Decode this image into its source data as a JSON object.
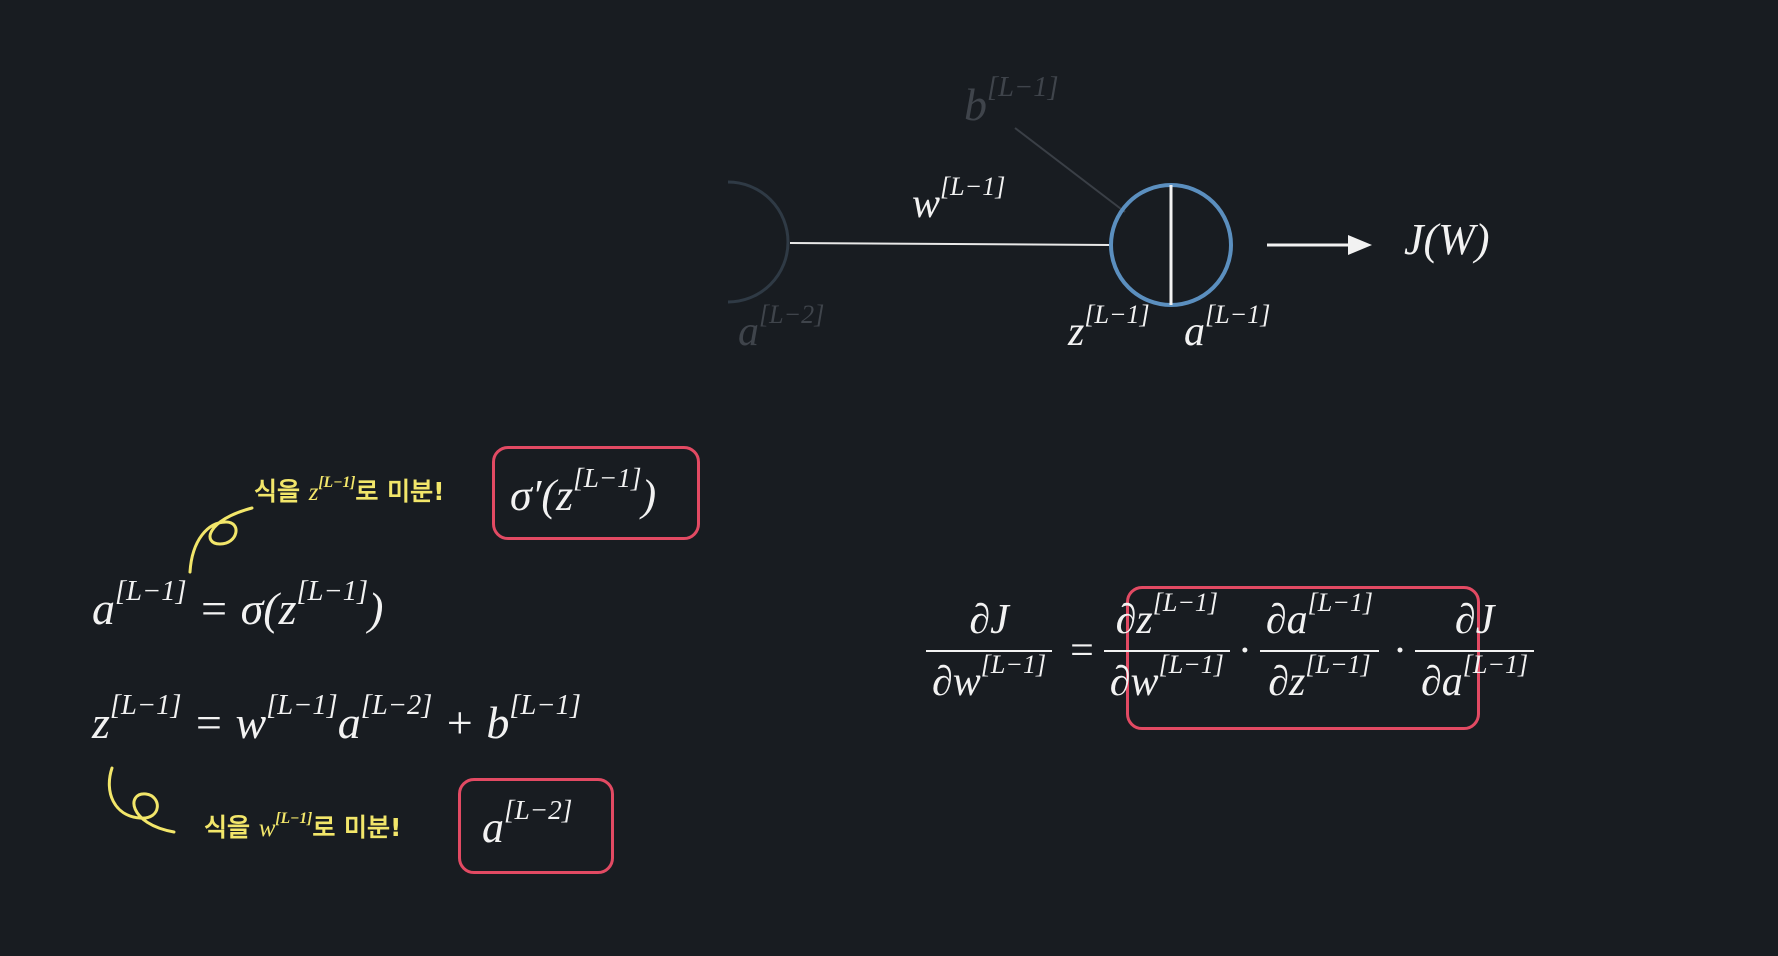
{
  "network": {
    "prev_label": "a",
    "prev_sup": "[L−2]",
    "weight_label": "w",
    "weight_sup": "[L−1]",
    "bias_label": "b",
    "bias_sup": "[L−1]",
    "z_label": "z",
    "z_sup": "[L−1]",
    "a_label": "a",
    "a_sup": "[L−1]",
    "cost_label": "J(W)"
  },
  "left": {
    "top_note_prefix": "식을 ",
    "top_note_var": "z",
    "top_note_sup": "[L−1]",
    "top_note_suffix": "로 미분!",
    "top_result": "σ′(z",
    "top_result_sup": "[L−1]",
    "top_result_close": ")",
    "eq1_lhs": "a",
    "eq1_lhs_sup": "[L−1]",
    "eq1_rhs": " = σ(z",
    "eq1_rhs_sup": "[L−1]",
    "eq1_close": ")",
    "eq2_lhs": "z",
    "eq2_lhs_sup": "[L−1]",
    "eq2_w": " = w",
    "eq2_w_sup": "[L−1]",
    "eq2_a": "a",
    "eq2_a_sup": "[L−2]",
    "eq2_b": " + b",
    "eq2_b_sup": "[L−1]",
    "bottom_note_prefix": "식을 ",
    "bottom_note_var": "w",
    "bottom_note_sup": "[L−1]",
    "bottom_note_suffix": "로 미분!",
    "bottom_result": "a",
    "bottom_result_sup": "[L−2]"
  },
  "chain": {
    "f1_num": "∂J",
    "f1_den": "∂w",
    "f1_den_sup": "[L−1]",
    "equals": "=",
    "f2_num": "∂z",
    "f2_num_sup": "[L−1]",
    "f2_den": "∂w",
    "f2_den_sup": "[L−1]",
    "dot": "·",
    "f3_num": "∂a",
    "f3_num_sup": "[L−1]",
    "f3_den": "∂z",
    "f3_den_sup": "[L−1]",
    "f4_num": "∂J",
    "f4_den": "∂a",
    "f4_den_sup": "[L−1]"
  },
  "colors": {
    "background": "#181c21",
    "highlight": "#e24a63",
    "annotation": "#f2e66a",
    "neuron": "#5b8fbf",
    "dim": "#3f444b"
  }
}
